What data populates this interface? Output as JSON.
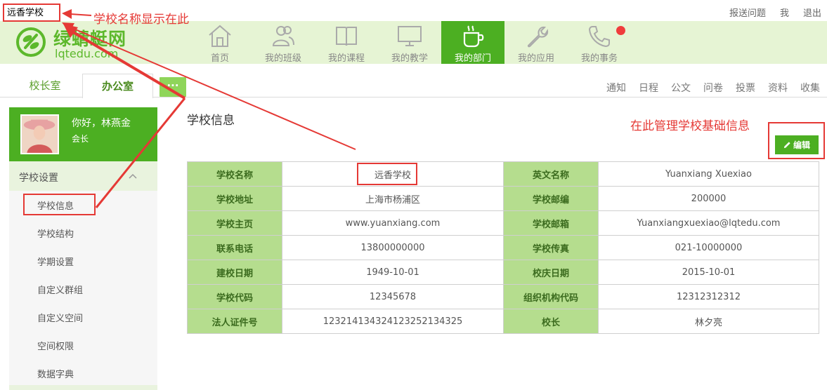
{
  "topbar": {
    "school_name": "远香学校",
    "links": [
      "报送问题",
      "我",
      "退出"
    ]
  },
  "logo": {
    "cn": "绿蜻蜓网",
    "en": "lqtedu.com"
  },
  "nav": {
    "items": [
      {
        "label": "首页",
        "icon": "home-icon"
      },
      {
        "label": "我的班级",
        "icon": "users-icon"
      },
      {
        "label": "我的课程",
        "icon": "book-icon"
      },
      {
        "label": "我的教学",
        "icon": "monitor-icon"
      },
      {
        "label": "我的部门",
        "icon": "coffee-cup-icon",
        "active": true
      },
      {
        "label": "我的应用",
        "icon": "wrench-icon"
      },
      {
        "label": "我的事务",
        "icon": "phone-icon"
      }
    ],
    "notification_color": "#f03c3c"
  },
  "tabs": {
    "items": [
      "校长室",
      "办公室"
    ],
    "more": "···",
    "tools": [
      "通知",
      "日程",
      "公文",
      "问卷",
      "投票",
      "资料",
      "收集"
    ]
  },
  "sidebar": {
    "greeting": "你好，林燕金",
    "role": "会长",
    "section": "学校设置",
    "menu": [
      "学校信息",
      "学校结构",
      "学期设置",
      "自定义群组",
      "自定义空间",
      "空间权限",
      "数据字典"
    ]
  },
  "main": {
    "title": "学校信息",
    "edit_label": "编辑",
    "rows": [
      {
        "k1": "学校名称",
        "v1": "远香学校",
        "k2": "英文名称",
        "v2": "Yuanxiang Xuexiao"
      },
      {
        "k1": "学校地址",
        "v1": "上海市杨浦区",
        "k2": "学校邮编",
        "v2": "200000"
      },
      {
        "k1": "学校主页",
        "v1": "www.yuanxiang.com",
        "k2": "学校邮箱",
        "v2": "Yuanxiangxuexiao@lqtedu.com"
      },
      {
        "k1": "联系电话",
        "v1": "13800000000",
        "k2": "学校传真",
        "v2": "021-10000000"
      },
      {
        "k1": "建校日期",
        "v1": "1949-10-01",
        "k2": "校庆日期",
        "v2": "2015-10-01"
      },
      {
        "k1": "学校代码",
        "v1": "12345678",
        "k2": "组织机构代码",
        "v2": "12312312312"
      },
      {
        "k1": "法人证件号",
        "v1": "12321413432412325213432​5",
        "k2": "校长",
        "v2": "林夕亮"
      }
    ]
  },
  "annotations": {
    "school_name_note": "学校名称显示在此",
    "manage_note": "在此管理学校基础信息",
    "color": "#e53935"
  },
  "colors": {
    "brand_green": "#4caf22",
    "header_bg": "#e6f4d4",
    "table_key_bg": "#b5dd8e"
  }
}
